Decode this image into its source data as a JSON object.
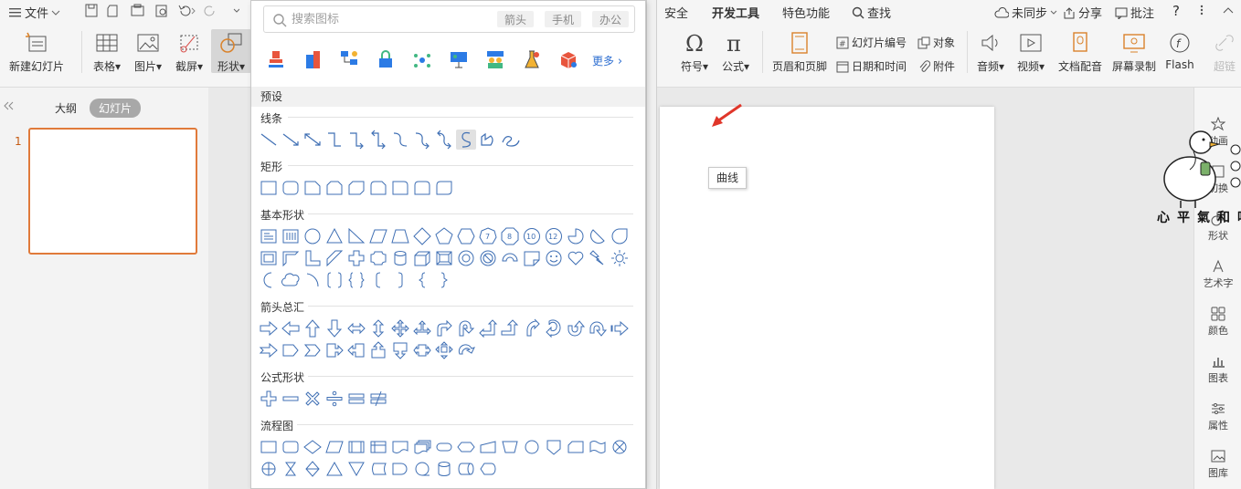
{
  "ribbon": {
    "file_menu": "文件",
    "tabs": [
      "安全",
      "开发工具",
      "特色功能"
    ],
    "search_label": "查找",
    "sync_label": "未同步",
    "share_label": "分享",
    "comment_label": "批注",
    "help_label": "?",
    "buttons": {
      "new_slide": "新建幻灯片",
      "table": "表格",
      "picture": "图片",
      "screenshot": "截屏",
      "shape": "形状",
      "symbol": "符号",
      "formula": "公式",
      "header_footer": "页眉和页脚",
      "slide_number": "幻灯片编号",
      "object": "对象",
      "date_time": "日期和时间",
      "attachment": "附件",
      "audio": "音频",
      "video": "视频",
      "doc_dub": "文档配音",
      "screen_record": "屏幕录制",
      "flash": "Flash",
      "hyperlink": "超链"
    }
  },
  "left_panel": {
    "tab_outline": "大纲",
    "tab_slides": "幻灯片",
    "slide_number": "1"
  },
  "shape_panel": {
    "search_placeholder": "搜索图标",
    "search_tags": [
      "箭头",
      "手机",
      "办公"
    ],
    "more_label": "更多",
    "preset_label": "预设",
    "sections": {
      "lines": "线条",
      "rectangles": "矩形",
      "basic": "基本形状",
      "arrows": "箭头总汇",
      "formula": "公式形状",
      "flowchart": "流程图"
    },
    "tooltip": "曲线"
  },
  "right_sidebar": {
    "items": [
      "动画",
      "切换",
      "形状",
      "艺术字",
      "颜色",
      "图表",
      "属性",
      "图库"
    ]
  },
  "watermark_text": "心平氣和吧"
}
